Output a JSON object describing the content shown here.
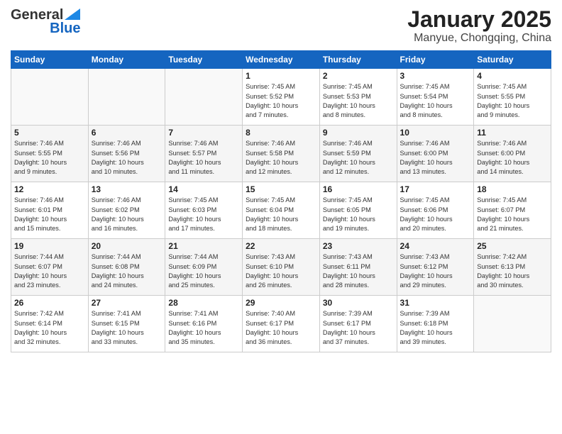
{
  "header": {
    "logo_line1": "General",
    "logo_line2": "Blue",
    "month": "January 2025",
    "location": "Manyue, Chongqing, China"
  },
  "weekdays": [
    "Sunday",
    "Monday",
    "Tuesday",
    "Wednesday",
    "Thursday",
    "Friday",
    "Saturday"
  ],
  "weeks": [
    [
      {
        "day": "",
        "info": ""
      },
      {
        "day": "",
        "info": ""
      },
      {
        "day": "",
        "info": ""
      },
      {
        "day": "1",
        "info": "Sunrise: 7:45 AM\nSunset: 5:52 PM\nDaylight: 10 hours\nand 7 minutes."
      },
      {
        "day": "2",
        "info": "Sunrise: 7:45 AM\nSunset: 5:53 PM\nDaylight: 10 hours\nand 8 minutes."
      },
      {
        "day": "3",
        "info": "Sunrise: 7:45 AM\nSunset: 5:54 PM\nDaylight: 10 hours\nand 8 minutes."
      },
      {
        "day": "4",
        "info": "Sunrise: 7:45 AM\nSunset: 5:55 PM\nDaylight: 10 hours\nand 9 minutes."
      }
    ],
    [
      {
        "day": "5",
        "info": "Sunrise: 7:46 AM\nSunset: 5:55 PM\nDaylight: 10 hours\nand 9 minutes."
      },
      {
        "day": "6",
        "info": "Sunrise: 7:46 AM\nSunset: 5:56 PM\nDaylight: 10 hours\nand 10 minutes."
      },
      {
        "day": "7",
        "info": "Sunrise: 7:46 AM\nSunset: 5:57 PM\nDaylight: 10 hours\nand 11 minutes."
      },
      {
        "day": "8",
        "info": "Sunrise: 7:46 AM\nSunset: 5:58 PM\nDaylight: 10 hours\nand 12 minutes."
      },
      {
        "day": "9",
        "info": "Sunrise: 7:46 AM\nSunset: 5:59 PM\nDaylight: 10 hours\nand 12 minutes."
      },
      {
        "day": "10",
        "info": "Sunrise: 7:46 AM\nSunset: 6:00 PM\nDaylight: 10 hours\nand 13 minutes."
      },
      {
        "day": "11",
        "info": "Sunrise: 7:46 AM\nSunset: 6:00 PM\nDaylight: 10 hours\nand 14 minutes."
      }
    ],
    [
      {
        "day": "12",
        "info": "Sunrise: 7:46 AM\nSunset: 6:01 PM\nDaylight: 10 hours\nand 15 minutes."
      },
      {
        "day": "13",
        "info": "Sunrise: 7:46 AM\nSunset: 6:02 PM\nDaylight: 10 hours\nand 16 minutes."
      },
      {
        "day": "14",
        "info": "Sunrise: 7:45 AM\nSunset: 6:03 PM\nDaylight: 10 hours\nand 17 minutes."
      },
      {
        "day": "15",
        "info": "Sunrise: 7:45 AM\nSunset: 6:04 PM\nDaylight: 10 hours\nand 18 minutes."
      },
      {
        "day": "16",
        "info": "Sunrise: 7:45 AM\nSunset: 6:05 PM\nDaylight: 10 hours\nand 19 minutes."
      },
      {
        "day": "17",
        "info": "Sunrise: 7:45 AM\nSunset: 6:06 PM\nDaylight: 10 hours\nand 20 minutes."
      },
      {
        "day": "18",
        "info": "Sunrise: 7:45 AM\nSunset: 6:07 PM\nDaylight: 10 hours\nand 21 minutes."
      }
    ],
    [
      {
        "day": "19",
        "info": "Sunrise: 7:44 AM\nSunset: 6:07 PM\nDaylight: 10 hours\nand 23 minutes."
      },
      {
        "day": "20",
        "info": "Sunrise: 7:44 AM\nSunset: 6:08 PM\nDaylight: 10 hours\nand 24 minutes."
      },
      {
        "day": "21",
        "info": "Sunrise: 7:44 AM\nSunset: 6:09 PM\nDaylight: 10 hours\nand 25 minutes."
      },
      {
        "day": "22",
        "info": "Sunrise: 7:43 AM\nSunset: 6:10 PM\nDaylight: 10 hours\nand 26 minutes."
      },
      {
        "day": "23",
        "info": "Sunrise: 7:43 AM\nSunset: 6:11 PM\nDaylight: 10 hours\nand 28 minutes."
      },
      {
        "day": "24",
        "info": "Sunrise: 7:43 AM\nSunset: 6:12 PM\nDaylight: 10 hours\nand 29 minutes."
      },
      {
        "day": "25",
        "info": "Sunrise: 7:42 AM\nSunset: 6:13 PM\nDaylight: 10 hours\nand 30 minutes."
      }
    ],
    [
      {
        "day": "26",
        "info": "Sunrise: 7:42 AM\nSunset: 6:14 PM\nDaylight: 10 hours\nand 32 minutes."
      },
      {
        "day": "27",
        "info": "Sunrise: 7:41 AM\nSunset: 6:15 PM\nDaylight: 10 hours\nand 33 minutes."
      },
      {
        "day": "28",
        "info": "Sunrise: 7:41 AM\nSunset: 6:16 PM\nDaylight: 10 hours\nand 35 minutes."
      },
      {
        "day": "29",
        "info": "Sunrise: 7:40 AM\nSunset: 6:17 PM\nDaylight: 10 hours\nand 36 minutes."
      },
      {
        "day": "30",
        "info": "Sunrise: 7:39 AM\nSunset: 6:17 PM\nDaylight: 10 hours\nand 37 minutes."
      },
      {
        "day": "31",
        "info": "Sunrise: 7:39 AM\nSunset: 6:18 PM\nDaylight: 10 hours\nand 39 minutes."
      },
      {
        "day": "",
        "info": ""
      }
    ]
  ]
}
